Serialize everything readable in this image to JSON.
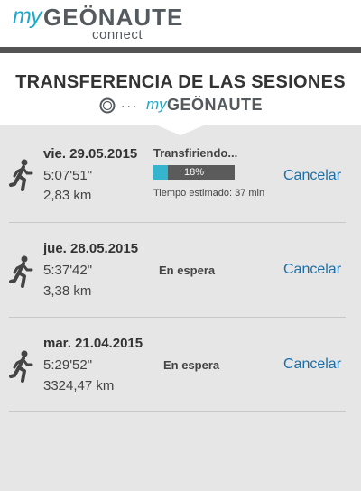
{
  "header": {
    "logo_my": "my",
    "logo_brand": "GEÖNAUTE",
    "logo_sub": "connect"
  },
  "transfer": {
    "title": "TRANSFERENCIA DE LAS SESIONES",
    "dots": "...",
    "logo_my": "my",
    "logo_brand": "GEÖNAUTE"
  },
  "sessions": [
    {
      "date": "vie. 29.05.2015",
      "duration": "5:07'51\"",
      "distance": "2,83 km",
      "status": "Transfiriendo...",
      "progress_percent": 18,
      "progress_label": "18%",
      "estimate": "Tiempo estimado: 37 min",
      "cancel_label": "Cancelar"
    },
    {
      "date": "jue. 28.05.2015",
      "duration": "5:37'42\"",
      "distance": "3,38 km",
      "status": "En espera",
      "cancel_label": "Cancelar"
    },
    {
      "date": "mar. 21.04.2015",
      "duration": "5:29'52\"",
      "distance": "3324,47 km",
      "status": "En espera",
      "cancel_label": "Cancelar"
    }
  ],
  "colors": {
    "brand_blue": "#1fa8c9",
    "progress_fill": "#35b4cd",
    "link_blue": "#1b6fa8",
    "dark_bar": "#545454"
  }
}
